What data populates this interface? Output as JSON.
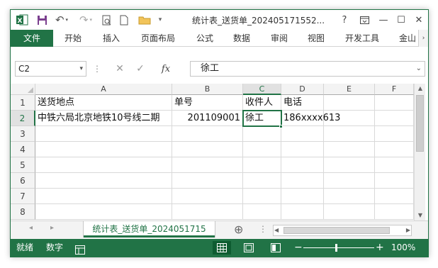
{
  "titlebar": {
    "title": "统计表_送货单_202405171552...",
    "help": "?",
    "restore_ribbon": "⊡",
    "minimize": "—",
    "maximize": "☐",
    "close": "✕",
    "app_icon_letter": "X"
  },
  "ribbon": {
    "tabs": [
      "文件",
      "开始",
      "插入",
      "页面布局",
      "公式",
      "数据",
      "审阅",
      "视图",
      "开发工具",
      "金山"
    ],
    "scroll_right": "›"
  },
  "formula_bar": {
    "name_box": "C2",
    "fx": "fx",
    "value": "徐工"
  },
  "grid": {
    "columns": [
      "A",
      "B",
      "C",
      "D",
      "E",
      "F"
    ],
    "rows": [
      "1",
      "2",
      "3",
      "4",
      "5",
      "6",
      "7",
      "8"
    ],
    "selected_cell": "C2",
    "cells": {
      "A1": "送货地点",
      "B1": "单号",
      "C1": "收件人",
      "D1": "电话",
      "A2": "中铁六局北京地铁10号线二期",
      "B2": "201109001",
      "C2": "徐工",
      "D2": "186xxxx613"
    }
  },
  "sheets": {
    "active": "统计表_送货单_2024051715",
    "add": "⊕",
    "more": "⋮"
  },
  "statusbar": {
    "ready": "就绪",
    "numlock": "数字",
    "zoom": "100%"
  },
  "colors": {
    "accent": "#217346",
    "accent_dark": "#0e5c31"
  }
}
